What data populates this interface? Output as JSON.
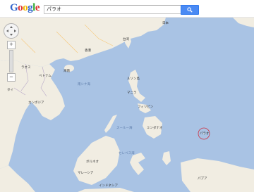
{
  "logo_text": "Google",
  "logo_letters": [
    "G",
    "o",
    "o",
    "g",
    "l",
    "e"
  ],
  "search": {
    "value": "パラオ",
    "button_icon": "search-icon"
  },
  "controls": {
    "pan_icon": "pan-control-icon",
    "zoom_in": "+",
    "zoom_out": "−"
  },
  "labels": {
    "japan": "日本",
    "taiwan": "台湾",
    "vietnam": "ベトナム",
    "laos": "ラオス",
    "thailand": "タイ",
    "cambodia": "カンボジア",
    "philippines": "フィリピン",
    "south_china_sea": "南シナ海",
    "sulu_sea": "スールー海",
    "celebes_sea": "セレベス海",
    "borneo": "ボルネオ",
    "malaysia": "マレーシア",
    "indonesia": "インドネシア",
    "palau": "パラオ",
    "hong_kong": "香港",
    "manila": "マニラ",
    "hainan": "海南",
    "luzon": "ルソン島",
    "mindanao": "ミンダナオ",
    "papua": "パプア"
  }
}
